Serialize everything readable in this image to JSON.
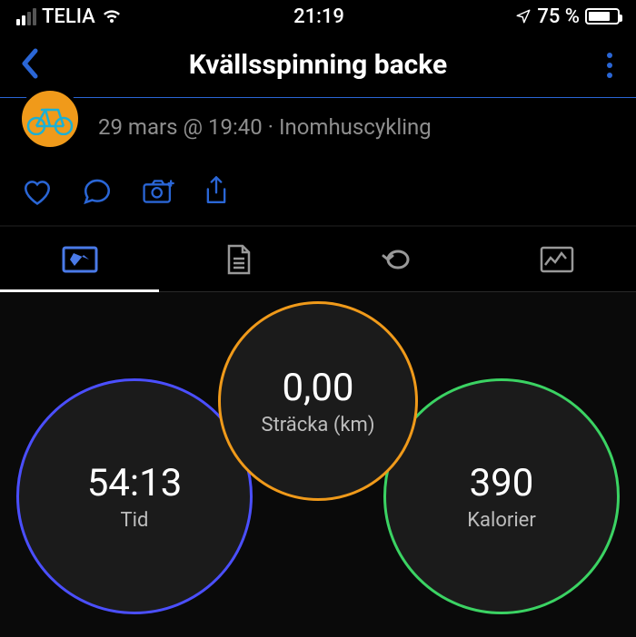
{
  "status": {
    "carrier": "TELIA",
    "time": "21:19",
    "battery": "75 %"
  },
  "nav": {
    "title": "Kvällsspinning backe"
  },
  "activity": {
    "meta": "29 mars @ 19:40 · Inomhuscykling"
  },
  "metrics": {
    "time_value": "54:13",
    "time_label": "Tid",
    "distance_value": "0,00",
    "distance_label": "Sträcka (km)",
    "calories_value": "390",
    "calories_label": "Kalorier"
  }
}
